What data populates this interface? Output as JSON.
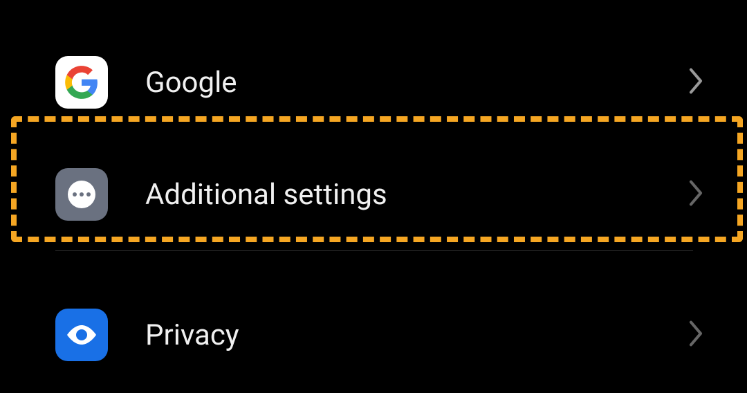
{
  "settings": {
    "items": [
      {
        "label": "Google",
        "icon": "google"
      },
      {
        "label": "Additional settings",
        "icon": "more"
      },
      {
        "label": "Privacy",
        "icon": "privacy"
      }
    ]
  },
  "highlighted_item_index": 1
}
